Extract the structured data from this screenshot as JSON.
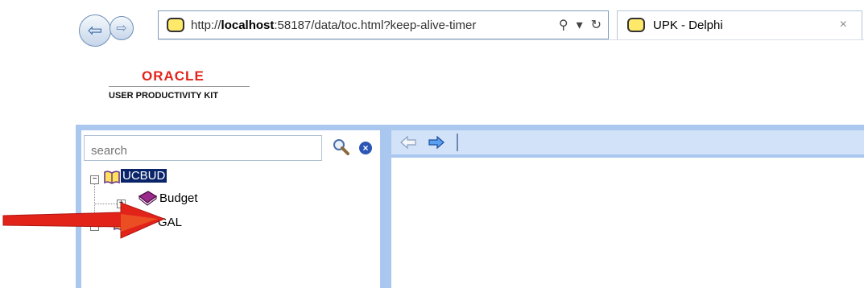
{
  "browser": {
    "address_prefix": "http://",
    "address_host": "localhost",
    "address_rest": ":58187/data/toc.html?keep-alive-timer",
    "search_glyph": "⚲",
    "dropdown_glyph": "▾",
    "refresh_glyph": "↻",
    "tab_title": "UPK - Delphi",
    "tab_close": "×",
    "nav_back_glyph": "⇦",
    "nav_fwd_glyph": "⇨"
  },
  "logo": {
    "brand": "ORACLE",
    "product": "USER PRODUCTIVITY KIT"
  },
  "toc": {
    "search_placeholder": "search",
    "clear_glyph": "×",
    "tree": [
      {
        "label": "UCBUD",
        "toggle": "−",
        "selected": true
      },
      {
        "label": "Budget",
        "toggle": "+",
        "selected": false
      },
      {
        "label": "GAL",
        "toggle": "−",
        "selected": false
      }
    ]
  },
  "colors": {
    "frame_blue": "#a9c7ef",
    "arrow_red": "#e2231a",
    "selection": "#0a246a"
  }
}
